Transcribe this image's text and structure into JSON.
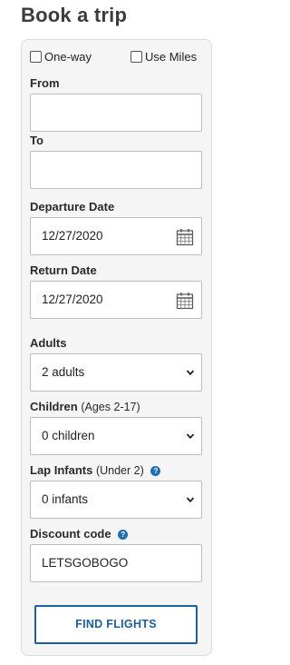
{
  "header": {
    "title": "Book a trip"
  },
  "options": {
    "one_way_label": "One-way",
    "use_miles_label": "Use Miles"
  },
  "form": {
    "from_label": "From",
    "from_value": "",
    "to_label": "To",
    "to_value": "",
    "departure_label": "Departure Date",
    "departure_value": "12/27/2020",
    "return_label": "Return Date",
    "return_value": "12/27/2020",
    "adults_label": "Adults",
    "adults_value": "2 adults",
    "children_label": "Children",
    "children_sub": "(Ages 2-17)",
    "children_value": "0 children",
    "infants_label": "Lap Infants",
    "infants_sub": "(Under 2)",
    "infants_value": "0 infants",
    "discount_label": "Discount code",
    "discount_value": "LETSGOBOGO",
    "help_glyph": "?"
  },
  "actions": {
    "find_flights_label": "FIND FLIGHTS"
  },
  "colors": {
    "accent": "#1a5fa0",
    "help_icon": "#1e6fb8",
    "panel_bg": "#f5f5f5"
  },
  "icons": {
    "calendar": "calendar-icon",
    "dropdown": "chevron-down-icon",
    "help": "help-icon"
  }
}
